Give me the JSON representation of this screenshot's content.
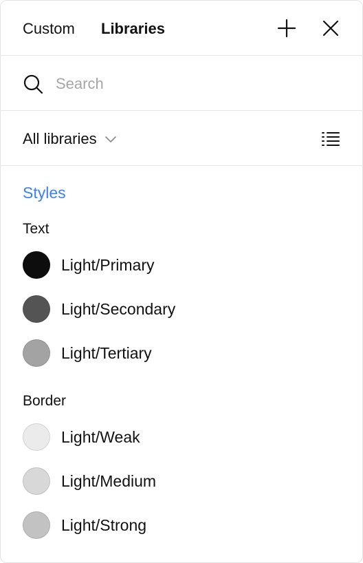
{
  "header": {
    "tabs": [
      {
        "label": "Custom"
      },
      {
        "label": "Libraries"
      }
    ],
    "add_icon": "plus-icon",
    "close_icon": "close-icon"
  },
  "search": {
    "icon": "search-icon",
    "placeholder": "Search",
    "value": ""
  },
  "filter": {
    "library_label": "All libraries",
    "dropdown_icon": "chevron-down-icon",
    "view_icon": "list-view-icon"
  },
  "styles": {
    "title": "Styles",
    "accent_color": "#3b82f6",
    "groups": [
      {
        "title": "Text",
        "items": [
          {
            "label": "Light/Primary",
            "color": "#0d0d0d"
          },
          {
            "label": "Light/Secondary",
            "color": "#545454"
          },
          {
            "label": "Light/Tertiary",
            "color": "#a3a3a3"
          }
        ]
      },
      {
        "title": "Border",
        "items": [
          {
            "label": "Light/Weak",
            "color": "#ebebeb"
          },
          {
            "label": "Light/Medium",
            "color": "#d8d8d8"
          },
          {
            "label": "Light/Strong",
            "color": "#c2c2c2"
          }
        ]
      }
    ]
  }
}
